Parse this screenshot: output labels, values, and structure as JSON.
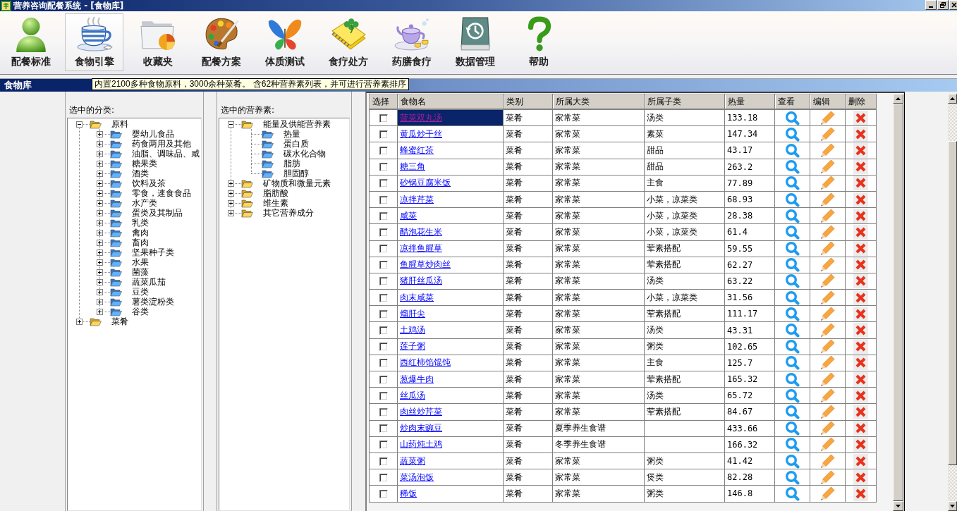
{
  "window": {
    "title": "营养咨询配餐系统 - [食物库]"
  },
  "toolbar": [
    {
      "label": "配餐标准",
      "selected": false
    },
    {
      "label": "食物引擎",
      "selected": true
    },
    {
      "label": "收藏夹",
      "selected": false
    },
    {
      "label": "配餐方案",
      "selected": false
    },
    {
      "label": "体质测试",
      "selected": false
    },
    {
      "label": "食疗处方",
      "selected": false
    },
    {
      "label": "药膳食疗",
      "selected": false
    },
    {
      "label": "数据管理",
      "selected": false
    },
    {
      "label": "帮助",
      "selected": false
    }
  ],
  "child_window": {
    "title": "食物库",
    "tooltip": "内置2100多种食物原料，3000余种菜肴。 含62种营养素列表，并可进行营养素排序"
  },
  "category_panel": {
    "label": "选中的分类:",
    "tree": [
      {
        "label": "原料",
        "expanded": true,
        "children": [
          {
            "label": "婴幼儿食品",
            "expanded": false
          },
          {
            "label": "药食两用及其他",
            "expanded": false
          },
          {
            "label": "油脂、调味品、咸",
            "expanded": false
          },
          {
            "label": "糖果类",
            "expanded": false
          },
          {
            "label": "酒类",
            "expanded": false
          },
          {
            "label": "饮料及茶",
            "expanded": false
          },
          {
            "label": "零食，速食食品",
            "expanded": false
          },
          {
            "label": "水产类",
            "expanded": false
          },
          {
            "label": "蛋类及其制品",
            "expanded": false
          },
          {
            "label": "乳类",
            "expanded": false
          },
          {
            "label": "禽肉",
            "expanded": false
          },
          {
            "label": "畜肉",
            "expanded": false
          },
          {
            "label": "坚果种子类",
            "expanded": false
          },
          {
            "label": "水果",
            "expanded": false
          },
          {
            "label": "菌藻",
            "expanded": false
          },
          {
            "label": "蔬菜瓜茄",
            "expanded": false
          },
          {
            "label": "豆类",
            "expanded": false
          },
          {
            "label": "薯类淀粉类",
            "expanded": false
          },
          {
            "label": "谷类",
            "expanded": false
          }
        ]
      },
      {
        "label": "菜肴",
        "expanded": false
      }
    ]
  },
  "nutrient_panel": {
    "label": "选中的营养素:",
    "tree": [
      {
        "label": "能量及供能营养素",
        "expanded": true,
        "children": [
          {
            "label": "热量"
          },
          {
            "label": "蛋白质"
          },
          {
            "label": "碳水化合物"
          },
          {
            "label": "脂肪"
          },
          {
            "label": "胆固醇"
          }
        ]
      },
      {
        "label": "矿物质和微量元素",
        "expanded": false
      },
      {
        "label": "脂肪酸",
        "expanded": false
      },
      {
        "label": "维生素",
        "expanded": false
      },
      {
        "label": "其它营养成分",
        "expanded": false
      }
    ]
  },
  "table": {
    "columns": [
      "选择",
      "食物名",
      "类别",
      "所属大类",
      "所属子类",
      "热量",
      "查看",
      "编辑",
      "删除"
    ],
    "rows": [
      {
        "checked": false,
        "selected": true,
        "name": "菠菜双丸汤",
        "type": "菜肴",
        "category": "家常菜",
        "subcategory": "汤类",
        "calories": "133.18"
      },
      {
        "checked": false,
        "selected": false,
        "name": "黄瓜炒干丝",
        "type": "菜肴",
        "category": "家常菜",
        "subcategory": "素菜",
        "calories": "147.34"
      },
      {
        "checked": false,
        "selected": false,
        "name": "蜂蜜红茶",
        "type": "菜肴",
        "category": "家常菜",
        "subcategory": "甜品",
        "calories": "43.17"
      },
      {
        "checked": false,
        "selected": false,
        "name": "糖三角",
        "type": "菜肴",
        "category": "家常菜",
        "subcategory": "甜品",
        "calories": "263.2"
      },
      {
        "checked": false,
        "selected": false,
        "name": "砂锅豆腐米饭",
        "type": "菜肴",
        "category": "家常菜",
        "subcategory": "主食",
        "calories": "77.89"
      },
      {
        "checked": false,
        "selected": false,
        "name": "凉拌芹菜",
        "type": "菜肴",
        "category": "家常菜",
        "subcategory": "小菜，凉菜类",
        "calories": "68.93"
      },
      {
        "checked": false,
        "selected": false,
        "name": "咸菜",
        "type": "菜肴",
        "category": "家常菜",
        "subcategory": "小菜，凉菜类",
        "calories": "28.38"
      },
      {
        "checked": false,
        "selected": false,
        "name": "醋泡花生米",
        "type": "菜肴",
        "category": "家常菜",
        "subcategory": "小菜，凉菜类",
        "calories": "61.4"
      },
      {
        "checked": false,
        "selected": false,
        "name": "凉拌鱼腥草",
        "type": "菜肴",
        "category": "家常菜",
        "subcategory": "荤素搭配",
        "calories": "59.55"
      },
      {
        "checked": false,
        "selected": false,
        "name": "鱼腥草炒肉丝",
        "type": "菜肴",
        "category": "家常菜",
        "subcategory": "荤素搭配",
        "calories": "62.27"
      },
      {
        "checked": false,
        "selected": false,
        "name": "猪肝丝瓜汤",
        "type": "菜肴",
        "category": "家常菜",
        "subcategory": "汤类",
        "calories": "63.22"
      },
      {
        "checked": false,
        "selected": false,
        "name": "肉末咸菜",
        "type": "菜肴",
        "category": "家常菜",
        "subcategory": "小菜，凉菜类",
        "calories": "31.56"
      },
      {
        "checked": false,
        "selected": false,
        "name": "熘肝尖",
        "type": "菜肴",
        "category": "家常菜",
        "subcategory": "荤素搭配",
        "calories": "111.17"
      },
      {
        "checked": false,
        "selected": false,
        "name": "土鸡汤",
        "type": "菜肴",
        "category": "家常菜",
        "subcategory": "汤类",
        "calories": "43.31"
      },
      {
        "checked": false,
        "selected": false,
        "name": "莲子粥",
        "type": "菜肴",
        "category": "家常菜",
        "subcategory": "粥类",
        "calories": "102.65"
      },
      {
        "checked": false,
        "selected": false,
        "name": "西红柿馅馄饨",
        "type": "菜肴",
        "category": "家常菜",
        "subcategory": "主食",
        "calories": "125.7"
      },
      {
        "checked": false,
        "selected": false,
        "name": "葱爆牛肉",
        "type": "菜肴",
        "category": "家常菜",
        "subcategory": "荤素搭配",
        "calories": "165.32"
      },
      {
        "checked": false,
        "selected": false,
        "name": "丝瓜汤",
        "type": "菜肴",
        "category": "家常菜",
        "subcategory": "汤类",
        "calories": "65.72"
      },
      {
        "checked": false,
        "selected": false,
        "name": "肉丝炒芹菜",
        "type": "菜肴",
        "category": "家常菜",
        "subcategory": "荤素搭配",
        "calories": "84.67"
      },
      {
        "checked": false,
        "selected": false,
        "name": "炒肉末豌豆",
        "type": "菜肴",
        "category": "夏季养生食谱",
        "calories": "433.66"
      },
      {
        "checked": false,
        "selected": false,
        "name": "山药炖土鸡",
        "type": "菜肴",
        "category": "冬季养生食谱",
        "calories": "166.32"
      },
      {
        "checked": false,
        "selected": false,
        "name": "蔬菜粥",
        "type": "菜肴",
        "category": "家常菜",
        "subcategory": "粥类",
        "calories": "41.42"
      },
      {
        "checked": false,
        "selected": false,
        "name": "菜汤泡饭",
        "type": "菜肴",
        "category": "家常菜",
        "subcategory": "煲类",
        "calories": "82.28"
      },
      {
        "checked": false,
        "selected": false,
        "name": "稀饭",
        "type": "菜肴",
        "category": "家常菜",
        "subcategory": "粥类",
        "calories": "146.8"
      }
    ]
  }
}
